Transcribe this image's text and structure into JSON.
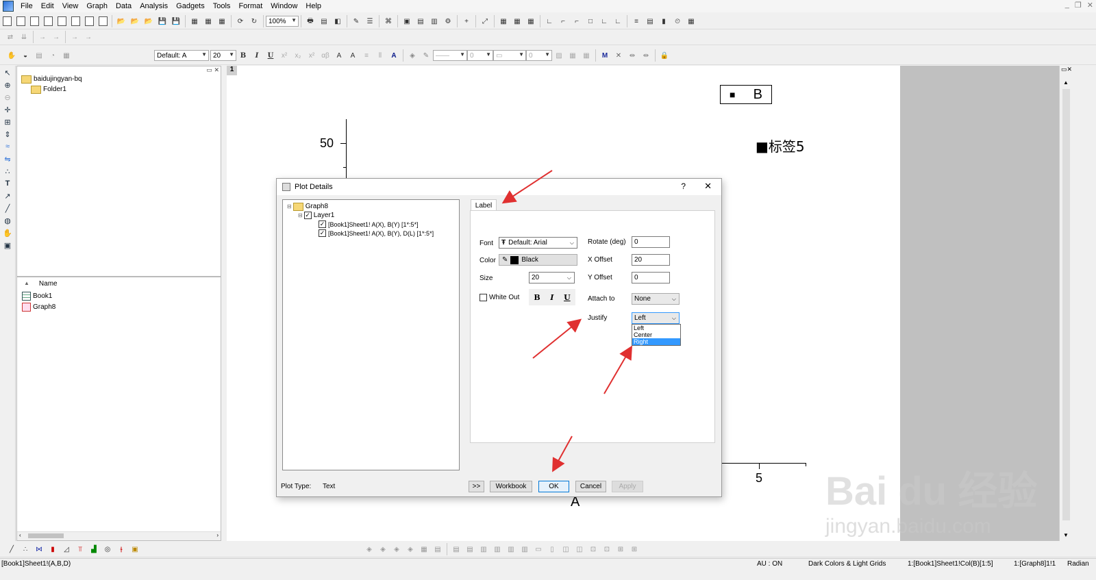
{
  "menu": [
    "File",
    "Edit",
    "View",
    "Graph",
    "Data",
    "Analysis",
    "Gadgets",
    "Tools",
    "Format",
    "Window",
    "Help"
  ],
  "toolbar": {
    "zoom": "100%",
    "font": "Default: A",
    "font_size": "20",
    "bold": "B",
    "italic": "I",
    "underline": "U"
  },
  "project": {
    "root": "baidujingyan-bq",
    "folder": "Folder1",
    "column_name": "Name",
    "items": [
      {
        "name": "Book1"
      },
      {
        "name": "Graph8"
      }
    ]
  },
  "graph": {
    "page_number": "1",
    "ytick": "50",
    "xtick": "5",
    "xlabel": "A",
    "legend_symbol": "■",
    "legend_text": "B",
    "label_text": "■标签5"
  },
  "dialog": {
    "title": "Plot Details",
    "help": "?",
    "close": "✕",
    "tree": {
      "graph": "Graph8",
      "layer": "Layer1",
      "plot1": "[Book1]Sheet1! A(X), B(Y) [1*:5*]",
      "plot2": "[Book1]Sheet1! A(X), B(Y), D(L) [1*:5*]"
    },
    "tab": "Label",
    "font_label": "Font",
    "font_value": "Default: Arial",
    "color_label": "Color",
    "color_value": "Black",
    "size_label": "Size",
    "size_value": "20",
    "whiteout_label": "White Out",
    "bold": "B",
    "italic": "I",
    "underline": "U",
    "rotate_label": "Rotate (deg)",
    "rotate_value": "0",
    "xoffset_label": "X Offset",
    "xoffset_value": "20",
    "yoffset_label": "Y Offset",
    "yoffset_value": "0",
    "attach_label": "Attach to",
    "attach_value": "None",
    "justify_label": "Justify",
    "justify_value": "Left",
    "justify_options": [
      "Left",
      "Center",
      "Right"
    ],
    "plot_type_label": "Plot Type:",
    "plot_type_value": "Text",
    "btn_more": ">>",
    "btn_workbook": "Workbook",
    "btn_ok": "OK",
    "btn_cancel": "Cancel",
    "btn_apply": "Apply"
  },
  "status": {
    "left": "[Book1]Sheet1!(A,B,D)",
    "au": "AU : ON",
    "theme": "Dark Colors & Light Grids",
    "col": "1:[Book1]Sheet1!Col(B)[1:5]",
    "graph": "1:[Graph8]1!1",
    "angle": "Radian"
  },
  "watermark": {
    "brand": "Bai du 经验",
    "url": "jingyan.baidu.com"
  },
  "colors": {
    "selection": "#3399ff",
    "arrow": "#e03030",
    "page": "#ffffff",
    "gray": "#c0c0c0"
  }
}
